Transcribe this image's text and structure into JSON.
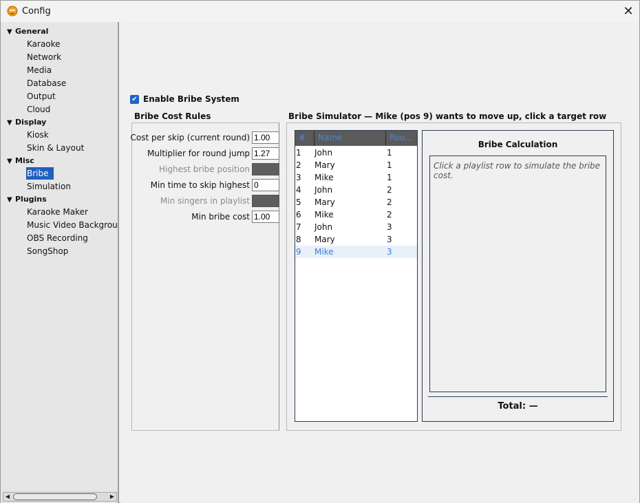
{
  "window": {
    "title": "Config"
  },
  "sidebar": {
    "groups": [
      {
        "label": "General",
        "items": [
          "Karaoke",
          "Network",
          "Media",
          "Database",
          "Output",
          "Cloud"
        ]
      },
      {
        "label": "Display",
        "items": [
          "Kiosk",
          "Skin & Layout"
        ]
      },
      {
        "label": "Misc",
        "items": [
          "Bribe",
          "Simulation"
        ]
      },
      {
        "label": "Plugins",
        "items": [
          "Karaoke Maker",
          "Music Video Background",
          "OBS Recording",
          "SongShop"
        ]
      }
    ],
    "selected": "Bribe"
  },
  "main": {
    "enable_label": "Enable Bribe System",
    "enabled": true,
    "rules_title": "Bribe Cost Rules",
    "rules": [
      {
        "label": "Cost per skip (current round)",
        "value": "1.00"
      },
      {
        "label": "Multiplier for round jump",
        "value": "1.27"
      },
      {
        "label": "Highest bribe position",
        "value": ""
      },
      {
        "label": "Min time to skip highest",
        "value": "0"
      },
      {
        "label": "Min singers in playlist",
        "value": ""
      },
      {
        "label": "Min bribe cost",
        "value": "1.00"
      }
    ],
    "simulator_title": "Bribe Simulator  —  Mike (pos 9) wants to move up, click a target row",
    "table": {
      "headers": [
        "#",
        "Name",
        "Rou..."
      ],
      "rows": [
        [
          "1",
          "John",
          "1"
        ],
        [
          "2",
          "Mary",
          "1"
        ],
        [
          "3",
          "Mike",
          "1"
        ],
        [
          "4",
          "John",
          "2"
        ],
        [
          "5",
          "Mary",
          "2"
        ],
        [
          "6",
          "Mike",
          "2"
        ],
        [
          "7",
          "John",
          "3"
        ],
        [
          "8",
          "Mary",
          "3"
        ],
        [
          "9",
          "Mike",
          "3"
        ]
      ]
    },
    "calc": {
      "title": "Bribe Calculation",
      "hint": "Click a playlist row to simulate the bribe cost.",
      "total": "Total: —"
    }
  },
  "colors": {
    "accent": "#1f5fbf",
    "selected_row_text": "#3a7bd5"
  }
}
